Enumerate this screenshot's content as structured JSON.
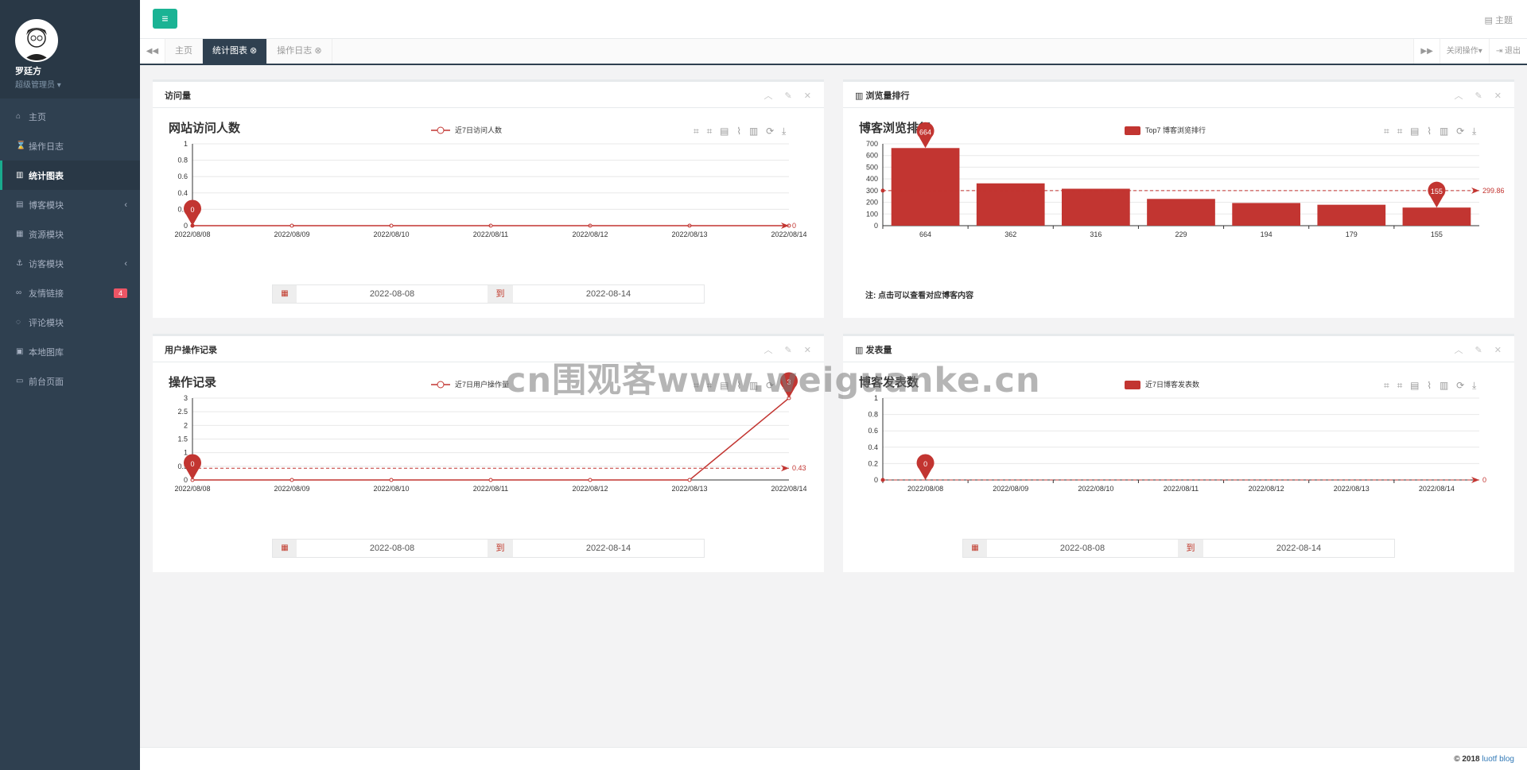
{
  "profile": {
    "name": "罗廷方",
    "role": "超级管理员 ▾"
  },
  "sidebar": {
    "items": [
      {
        "label": "主页",
        "icon": "home-icon",
        "glyph": "⌂"
      },
      {
        "label": "操作日志",
        "icon": "hourglass-icon",
        "glyph": "⌛"
      },
      {
        "label": "统计图表",
        "icon": "bar-chart-icon",
        "glyph": "▥",
        "active": true
      },
      {
        "label": "博客模块",
        "icon": "book-icon",
        "glyph": "▤",
        "arrow": "‹"
      },
      {
        "label": "资源模块",
        "icon": "grid-icon",
        "glyph": "▦"
      },
      {
        "label": "访客模块",
        "icon": "anchor-icon",
        "glyph": "⚓",
        "arrow": "‹"
      },
      {
        "label": "友情链接",
        "icon": "link-icon",
        "glyph": "∞",
        "badge": "4"
      },
      {
        "label": "评论模块",
        "icon": "comment-icon",
        "glyph": "◌"
      },
      {
        "label": "本地图库",
        "icon": "image-icon",
        "glyph": "▣"
      },
      {
        "label": "前台页面",
        "icon": "desktop-icon",
        "glyph": "▭"
      }
    ]
  },
  "topbar": {
    "menu_glyph": "≡",
    "theme": "▤ 主题"
  },
  "tabbar": {
    "prev": "◀◀",
    "next": "▶▶",
    "close_ops": "关闭操作▾",
    "logout": "⇥ 退出",
    "tabs": [
      {
        "label": "主页"
      },
      {
        "label": "统计图表 ⊗",
        "active": true
      },
      {
        "label": "操作日志 ⊗"
      }
    ]
  },
  "panels": {
    "visits": {
      "header": "访问量",
      "tools": "︿ ✎ ✕"
    },
    "rank": {
      "header": "▥ 浏览量排行",
      "tools": "︿ ✎ ✕",
      "note": "注: 点击可以查看对应博客内容"
    },
    "ops": {
      "header": "用户操作记录",
      "tools": "︿ ✎ ✕"
    },
    "posts": {
      "header": "▥ 发表量",
      "tools": "︿ ✎ ✕"
    }
  },
  "date_range": {
    "start": "2022-08-08",
    "end": "2022-08-14",
    "to": "到",
    "cal": "▦"
  },
  "chart_toolbar": "⌗ ⌗ ▤ ⌇ ▥ ⟳ ⤓",
  "colors": {
    "series": "#c23531",
    "accent": "#1ab394",
    "sidebar": "#2f4050"
  },
  "chart_data": [
    {
      "type": "line",
      "title": "网站访问人数",
      "legend": "近7日访问人数",
      "x": [
        "2022/08/08",
        "2022/08/09",
        "2022/08/10",
        "2022/08/11",
        "2022/08/12",
        "2022/08/13",
        "2022/08/14"
      ],
      "values": [
        0,
        0,
        0,
        0,
        0,
        0,
        0
      ],
      "ylim": [
        0,
        1
      ],
      "yticks": [
        "0",
        "0.2",
        "0.4",
        "0.6",
        "0.8",
        "1"
      ],
      "markpoint": "0",
      "markline": "0"
    },
    {
      "type": "bar",
      "title": "博客浏览排行",
      "legend": "Top7 博客浏览排行",
      "categories": [
        "664",
        "362",
        "316",
        "229",
        "194",
        "179",
        "155"
      ],
      "values": [
        664,
        362,
        316,
        229,
        194,
        179,
        155
      ],
      "ylim": [
        0,
        700
      ],
      "yticks": [
        "0",
        "100",
        "200",
        "300",
        "400",
        "500",
        "600",
        "700"
      ],
      "markpoint_max": "664",
      "markpoint_min": "155",
      "markline": "299.86"
    },
    {
      "type": "line",
      "title": "操作记录",
      "legend": "近7日用户操作量",
      "x": [
        "2022/08/08",
        "2022/08/09",
        "2022/08/10",
        "2022/08/11",
        "2022/08/12",
        "2022/08/13",
        "2022/08/14"
      ],
      "values": [
        0,
        0,
        0,
        0,
        0,
        0,
        3
      ],
      "ylim": [
        0,
        3
      ],
      "yticks": [
        "0",
        "0.5",
        "1",
        "1.5",
        "2",
        "2.5",
        "3"
      ],
      "markpoint_max": "3",
      "markpoint_min": "0",
      "markline": "0.43"
    },
    {
      "type": "bar",
      "title": "博客发表数",
      "legend": "近7日博客发表数",
      "categories": [
        "2022/08/08",
        "2022/08/09",
        "2022/08/10",
        "2022/08/11",
        "2022/08/12",
        "2022/08/13",
        "2022/08/14"
      ],
      "values": [
        0,
        0,
        0,
        0,
        0,
        0,
        0
      ],
      "ylim": [
        0,
        1
      ],
      "yticks": [
        "0",
        "0.2",
        "0.4",
        "0.6",
        "0.8",
        "1"
      ],
      "markpoint": "0",
      "markline": "0"
    }
  ],
  "watermark": "cn围观客www.weiguanke.cn",
  "footer": {
    "copyright": "© 2018",
    "brand": "luotf blog"
  }
}
